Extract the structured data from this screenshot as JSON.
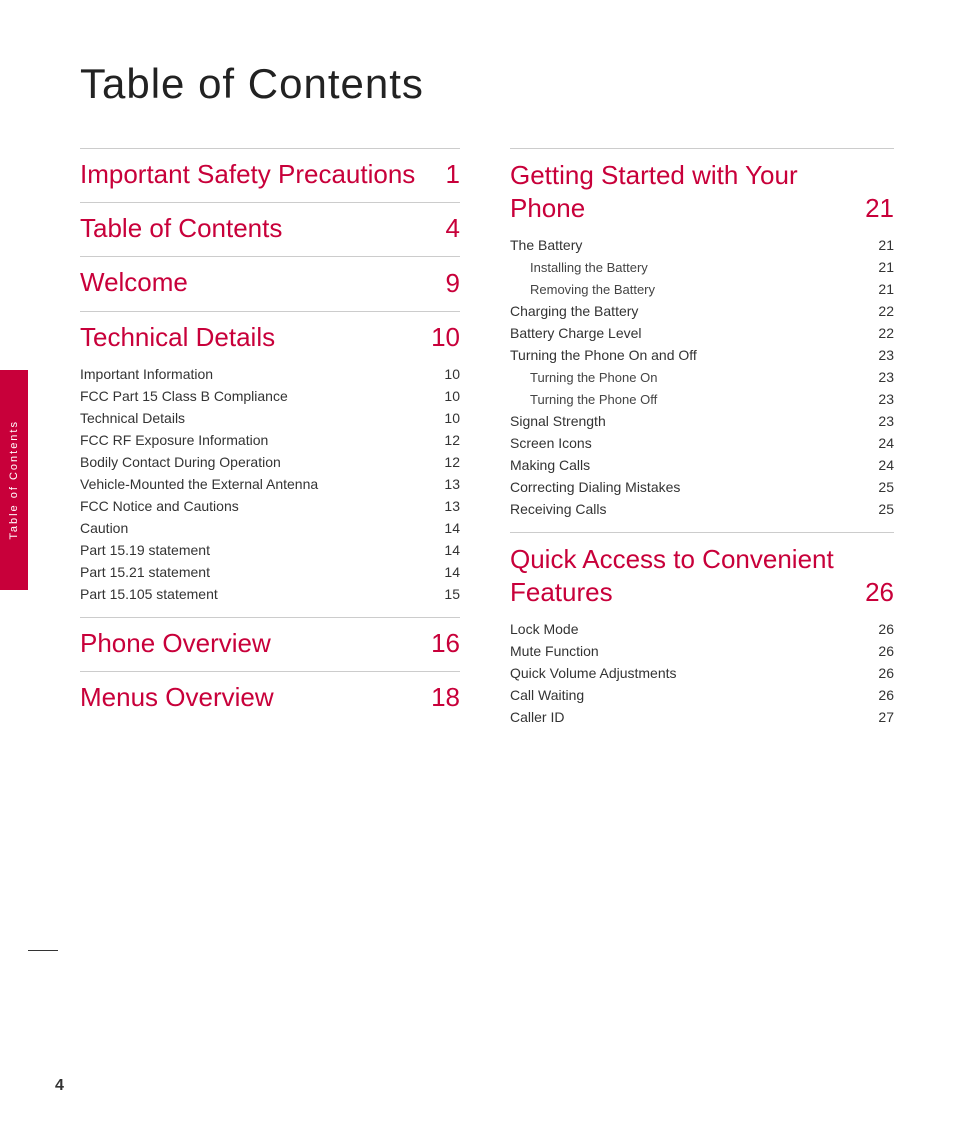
{
  "page": {
    "main_title": "Table of Contents",
    "page_number": "4",
    "sidebar_label": "Table of Contents"
  },
  "left_column": {
    "sections": [
      {
        "id": "important-safety",
        "title": "Important Safety Precautions",
        "number": "1",
        "sub_items": []
      },
      {
        "id": "table-of-contents",
        "title": "Table of Contents",
        "number": "4",
        "sub_items": []
      },
      {
        "id": "welcome",
        "title": "Welcome",
        "number": "9",
        "sub_items": []
      },
      {
        "id": "technical-details",
        "title": "Technical Details",
        "number": "10",
        "sub_items": [
          {
            "label": "Important Information",
            "number": "10",
            "indent": false
          },
          {
            "label": "FCC Part 15 Class B Compliance",
            "number": "10",
            "indent": false
          },
          {
            "label": "Technical Details",
            "number": "10",
            "indent": false
          },
          {
            "label": "FCC RF Exposure Information",
            "number": "12",
            "indent": false
          },
          {
            "label": "Bodily Contact During Operation",
            "number": "12",
            "indent": false
          },
          {
            "label": "Vehicle-Mounted the External Antenna",
            "number": "13",
            "indent": false
          },
          {
            "label": "FCC Notice and Cautions",
            "number": "13",
            "indent": false
          },
          {
            "label": "Caution",
            "number": "14",
            "indent": false
          },
          {
            "label": "Part 15.19 statement",
            "number": "14",
            "indent": false
          },
          {
            "label": "Part 15.21 statement",
            "number": "14",
            "indent": false
          },
          {
            "label": "Part 15.105 statement",
            "number": "15",
            "indent": false
          }
        ]
      },
      {
        "id": "phone-overview",
        "title": "Phone Overview",
        "number": "16",
        "sub_items": []
      },
      {
        "id": "menus-overview",
        "title": "Menus Overview",
        "number": "18",
        "sub_items": []
      }
    ]
  },
  "right_column": {
    "sections": [
      {
        "id": "getting-started",
        "title": "Getting Started with Your Phone",
        "number": "21",
        "sub_items": [
          {
            "label": "The Battery",
            "number": "21",
            "indent": false
          },
          {
            "label": "Installing the Battery",
            "number": "21",
            "indent": true
          },
          {
            "label": "Removing the Battery",
            "number": "21",
            "indent": true
          },
          {
            "label": "Charging the Battery",
            "number": "22",
            "indent": false
          },
          {
            "label": "Battery Charge Level",
            "number": "22",
            "indent": false
          },
          {
            "label": "Turning the Phone On and Off",
            "number": "23",
            "indent": false
          },
          {
            "label": "Turning the Phone On",
            "number": "23",
            "indent": true
          },
          {
            "label": "Turning the Phone Off",
            "number": "23",
            "indent": true
          },
          {
            "label": "Signal Strength",
            "number": "23",
            "indent": false
          },
          {
            "label": "Screen Icons",
            "number": "24",
            "indent": false
          },
          {
            "label": "Making Calls",
            "number": "24",
            "indent": false
          },
          {
            "label": "Correcting Dialing Mistakes",
            "number": "25",
            "indent": false
          },
          {
            "label": "Receiving Calls",
            "number": "25",
            "indent": false
          }
        ]
      },
      {
        "id": "quick-access",
        "title": "Quick Access to Convenient Features",
        "number": "26",
        "sub_items": [
          {
            "label": "Lock Mode",
            "number": "26",
            "indent": false
          },
          {
            "label": "Mute Function",
            "number": "26",
            "indent": false
          },
          {
            "label": "Quick Volume Adjustments",
            "number": "26",
            "indent": false
          },
          {
            "label": "Call Waiting",
            "number": "26",
            "indent": false
          },
          {
            "label": "Caller ID",
            "number": "27",
            "indent": false
          }
        ]
      }
    ]
  }
}
